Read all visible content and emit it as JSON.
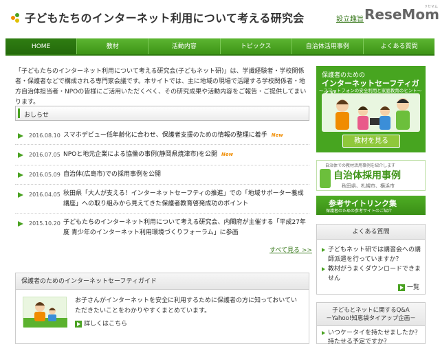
{
  "header": {
    "site_title": "子どもたちのインターネット利用について考える研究会",
    "about_link": "設立趣旨",
    "brand_logo": "ReseMom",
    "brand_sub": "リセマム"
  },
  "nav": {
    "items": [
      "HOME",
      "教材",
      "活動内容",
      "トピックス",
      "自治体活用事例",
      "よくある質問"
    ],
    "active_index": 0
  },
  "intro": {
    "text": "「子どもたちのインターネット利用について考える研究会(子どもネット研)」は、学識経験者・学校関係者・保護者などで構成される専門家会議です。本サイトでは、主に地域の現場で活躍する学校関係者・地方自治体担当者・NPOの皆様にご活用いただくべく、その研究成果や活動内容をご報告・ご提供してまいります。"
  },
  "notices": {
    "title": "おしらせ",
    "items": [
      {
        "date": "2016.08.10",
        "text": "スマホデビュー低年齢化に合わせ、保護者支援のための情報の整理に着手",
        "new": "New"
      },
      {
        "date": "2016.07.05",
        "text": "NPOと地元企業による協働の事例(静岡県焼津市)を公開",
        "new": "New"
      },
      {
        "date": "2016.05.09",
        "text": "自治体(広島市)での採用事例を公開",
        "new": ""
      },
      {
        "date": "2016.04.05",
        "text": "秋田県「大人が支える！インターネットセーフティの推進」での「地域サポーター養成講座」への取り組みから見えてきた保護者教育啓発成功のポイント",
        "new": ""
      },
      {
        "date": "2015.10.20",
        "text": "子どもたちのインターネット利用について考える研究会、内閣府が主催する「平成27年度 青少年のインターネット利用環境づくりフォーラム」に参画",
        "new": ""
      }
    ],
    "see_all": "すべて見る >>"
  },
  "guide": {
    "title": "保護者のためのインターネットセーフティガイド",
    "text": "お子さんがインターネットを安全に利用するために保護者の方に知っておいていただきたいことをわかりやすくまとめています。",
    "more": "詳しくはこちら"
  },
  "sidebar": {
    "banner1": {
      "line1": "保護者のための",
      "line2": "インターネットセーフティガイド",
      "line3": "～スマートフォンの安全利用と家庭教育のヒント～",
      "button": "教材を見る"
    },
    "banner2": {
      "small": "自治体での教材活用事例を紹介します",
      "main": "自治体採用事例",
      "cities": "秋田県、札幌市、横浜市"
    },
    "banner3": {
      "main": "参考サイトリンク集",
      "sub": "保護者のための参考サイトのご紹介"
    },
    "faq": {
      "title": "よくある質問",
      "items": [
        "子どもネット研では講習会への講師派遣を行っていますか？",
        "教材がうまくダウンロードできません"
      ],
      "more": "一覧"
    },
    "qa": {
      "title": "子どもとネットに関するQ&A",
      "subtitle": "－Yahoo!知恵袋タイアップ企画－",
      "items": [
        "いつケータイを持たせましたか？持たせる予定ですか？"
      ]
    }
  },
  "colors": {
    "brand_green": "#4aa222",
    "nav_active": "#2f7d12",
    "new_badge": "#f08c00"
  }
}
